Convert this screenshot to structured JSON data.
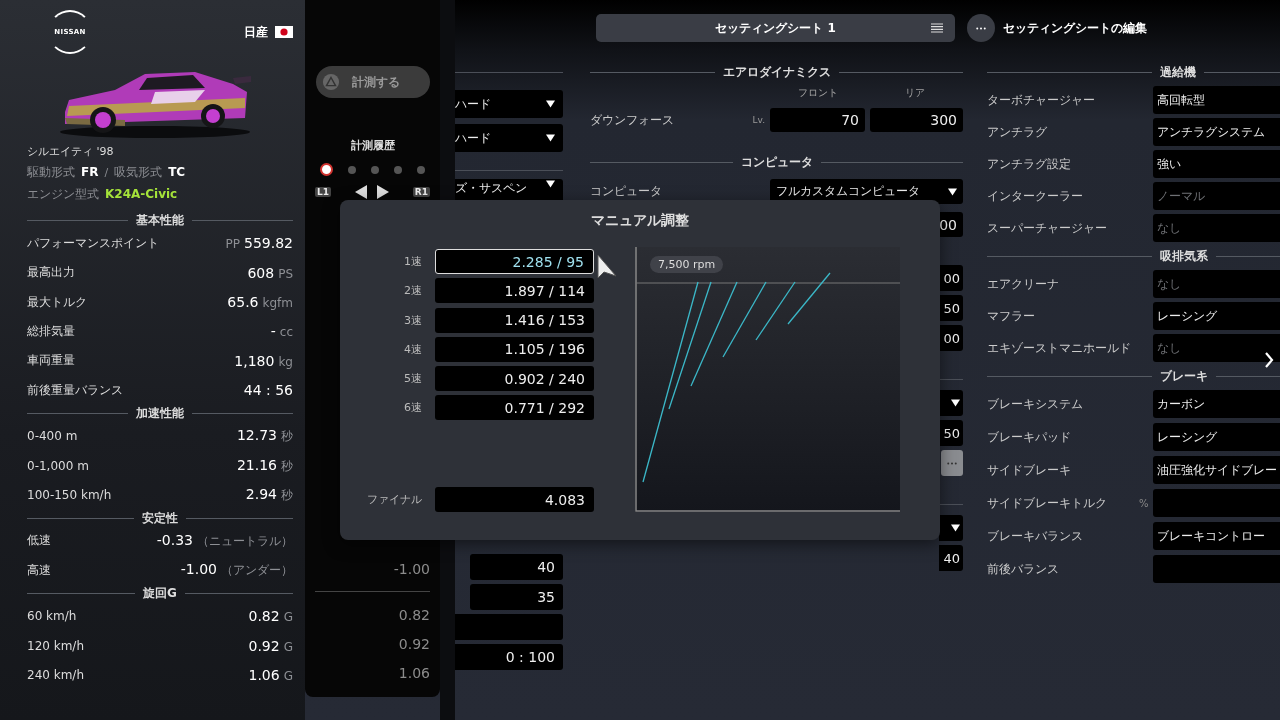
{
  "car": {
    "brand_logo": "NISSAN",
    "maker": "日産",
    "name": "シルエイティ '98",
    "specs": [
      {
        "label": "駆動形式",
        "value": "FR"
      },
      {
        "label": "吸気形式",
        "value": "TC"
      }
    ],
    "spec_separator": "/",
    "engine": {
      "label": "エンジン型式",
      "value": "K24A-Civic"
    }
  },
  "stats": [
    {
      "title": "基本性能",
      "rows": [
        {
          "label": "パフォーマンスポイント",
          "prefix": "PP",
          "value": "559.82"
        },
        {
          "label": "最高出力",
          "value": "608",
          "unit": "PS"
        },
        {
          "label": "最大トルク",
          "value": "65.6",
          "unit": "kgfm"
        },
        {
          "label": "総排気量",
          "value": "-",
          "unit": "cc"
        },
        {
          "label": "車両重量",
          "value": "1,180",
          "unit": "kg"
        },
        {
          "label": "前後重量バランス",
          "value": "44 : 56"
        }
      ]
    },
    {
      "title": "加速性能",
      "rows": [
        {
          "label": "0-400 m",
          "value": "12.73",
          "unit": "秒"
        },
        {
          "label": "0-1,000 m",
          "value": "21.16",
          "unit": "秒"
        },
        {
          "label": "100-150 km/h",
          "value": "2.94",
          "unit": "秒"
        }
      ]
    },
    {
      "title": "安定性",
      "rows": [
        {
          "label": "低速",
          "value": "-0.33",
          "unit": "（ニュートラル）"
        },
        {
          "label": "高速",
          "value": "-1.00",
          "unit": "（アンダー）"
        }
      ]
    },
    {
      "title": "旋回G",
      "rows": [
        {
          "label": "60 km/h",
          "value": "0.82",
          "unit": "G"
        },
        {
          "label": "120 km/h",
          "value": "0.92",
          "unit": "G"
        },
        {
          "label": "240 km/h",
          "value": "1.06",
          "unit": "G"
        }
      ]
    }
  ],
  "measurement": {
    "button": "計測する",
    "history_title": "計測履歴",
    "history": [
      {
        "selected": true
      },
      {
        "selected": false
      },
      {
        "selected": false
      },
      {
        "selected": false
      },
      {
        "selected": false
      }
    ],
    "prev_key": "L1",
    "next_key": "R1",
    "rows": [
      {
        "kind": "value",
        "value": "-1.00"
      },
      {
        "kind": "rule"
      },
      {
        "kind": "value",
        "value": "0.82"
      },
      {
        "kind": "value",
        "value": "0.92"
      },
      {
        "kind": "value",
        "value": "1.06"
      }
    ]
  },
  "suspension_column": {
    "top_rows": [
      {
        "kind": "dropdown",
        "value": "ハード"
      },
      {
        "kind": "dropdown",
        "value": "ハード"
      },
      {
        "kind": "dropdown",
        "value": "ズ・サスペン"
      }
    ],
    "bottom_rows": [
      {
        "kind": "field",
        "value": "40"
      },
      {
        "kind": "field",
        "value": "35"
      },
      {
        "kind": "field"
      },
      {
        "kind": "field",
        "value": "0 : 100"
      }
    ]
  },
  "sheet": {
    "title": "セッティングシート 1",
    "edit_label": "セッティングシートの編集",
    "aero": {
      "title": "エアロダイナミクス",
      "columns": [
        "フロント",
        "リア"
      ],
      "label": "ダウンフォース",
      "unit": "Lv.",
      "values": [
        "70",
        "300"
      ]
    },
    "computer": {
      "title": "コンピュータ",
      "label": "コンピュータ",
      "value": "フルカスタムコンピュータ",
      "sub_value": "00"
    },
    "covered_groups": [
      {
        "rows": [
          {
            "kind": "field",
            "value": "00"
          },
          {
            "kind": "field",
            "value": "50"
          },
          {
            "kind": "field",
            "value": "00"
          }
        ]
      },
      {
        "rows": [
          {
            "kind": "dropdown"
          },
          {
            "kind": "field",
            "value": "50"
          },
          {
            "kind": "button"
          }
        ]
      },
      {
        "rows": [
          {
            "kind": "dropdown"
          },
          {
            "kind": "field",
            "value": "40"
          }
        ]
      }
    ]
  },
  "tuning": {
    "sections": [
      {
        "title": "過給機",
        "rows": [
          {
            "label": "ターボチャージャー",
            "value": "高回転型",
            "dimmed": false
          },
          {
            "label": "アンチラグ",
            "value": "アンチラグシステム",
            "dimmed": false
          },
          {
            "label": "アンチラグ設定",
            "value": "強い",
            "dimmed": false
          },
          {
            "label": "インタークーラー",
            "value": "ノーマル",
            "dimmed": true
          },
          {
            "label": "スーパーチャージャー",
            "value": "なし",
            "dimmed": true
          }
        ]
      },
      {
        "title": "吸排気系",
        "rows": [
          {
            "label": "エアクリーナ",
            "value": "なし",
            "dimmed": true
          },
          {
            "label": "マフラー",
            "value": "レーシング",
            "dimmed": false
          },
          {
            "label": "エキゾーストマニホールド",
            "value": "なし",
            "dimmed": true
          }
        ]
      },
      {
        "title": "ブレーキ",
        "rows": [
          {
            "label": "ブレーキシステム",
            "value": "カーボン",
            "dimmed": false
          },
          {
            "label": "ブレーキパッド",
            "value": "レーシング",
            "dimmed": false
          },
          {
            "label": "サイドブレーキ",
            "value": "油圧強化サイドブレー",
            "dimmed": false
          },
          {
            "label": "サイドブレーキトルク",
            "unit": "%"
          },
          {
            "label": "ブレーキバランス",
            "value": "ブレーキコントロー",
            "dimmed": false
          },
          {
            "label": "前後バランス"
          }
        ]
      }
    ]
  },
  "dialog": {
    "title": "マニュアル調整",
    "gears": [
      {
        "label": "1速",
        "value": "2.285 / 95",
        "selected": true
      },
      {
        "label": "2速",
        "value": "1.897 / 114",
        "selected": false
      },
      {
        "label": "3速",
        "value": "1.416 / 153",
        "selected": false
      },
      {
        "label": "4速",
        "value": "1.105 / 196",
        "selected": false
      },
      {
        "label": "5速",
        "value": "0.902 / 240",
        "selected": false
      },
      {
        "label": "6速",
        "value": "0.771 / 292",
        "selected": false
      }
    ],
    "final": {
      "label": "ファイナル",
      "value": "4.083"
    },
    "graph_label": "7,500 rpm"
  }
}
